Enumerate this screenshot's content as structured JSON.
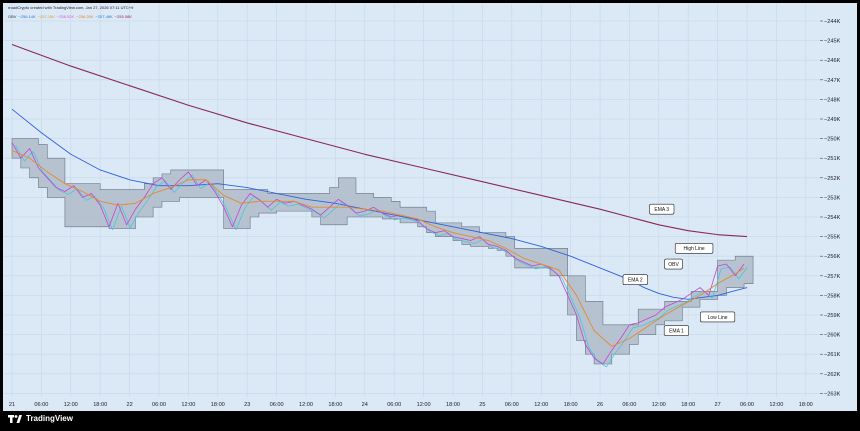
{
  "header": {
    "credit": "rroadCrypto created with TradingView.com, Jan 27, 2026 07:11 UTC+9",
    "legend": [
      {
        "text": "OBV",
        "color": "#333333"
      },
      {
        "text": "−256.14K",
        "color": "#2b7bd6"
      },
      {
        "text": "−257.15K",
        "color": "#e0a030"
      },
      {
        "text": "−256.52K",
        "color": "#d658d6"
      },
      {
        "text": "−256.26K",
        "color": "#e58a2a"
      },
      {
        "text": "−257.46K",
        "color": "#2b7bd6"
      },
      {
        "text": "−255.08K",
        "color": "#9a2a5a"
      }
    ]
  },
  "footer": {
    "brand": "TradingView"
  },
  "colors": {
    "background": "#dbe8f6",
    "grid": "#c7d7e8",
    "obv": "#c246d6",
    "obv_cyan": "#3fc6d8",
    "ema1": "#e58a2a",
    "ema2": "#2b62e0",
    "ema3": "#8a2a55",
    "band_fill": "#a9b5c3",
    "band_edge": "#6a7482"
  },
  "chart_data": {
    "type": "line",
    "title": "OBV",
    "x_labels": [
      "21",
      "06:00",
      "12:00",
      "18:00",
      "22",
      "06:00",
      "12:00",
      "18:00",
      "23",
      "06:00",
      "12:00",
      "18:00",
      "24",
      "06:00",
      "12:00",
      "18:00",
      "25",
      "06:00",
      "12:00",
      "18:00",
      "26",
      "06:00",
      "12:00",
      "18:00",
      "27",
      "06:00",
      "12:00",
      "18:00"
    ],
    "y_tick_labels": [
      "−244K",
      "−245K",
      "−246K",
      "−247K",
      "−248K",
      "−249K",
      "−250K",
      "−251K",
      "−252K",
      "−253K",
      "−254K",
      "−255K",
      "−256K",
      "−257K",
      "−258K",
      "−259K",
      "−260K",
      "−261K",
      "−262K",
      "−263K"
    ],
    "ylim": [
      -263,
      -244
    ],
    "y_unit": "K",
    "xlim": [
      0,
      27.3
    ],
    "grid": true,
    "series": [
      {
        "name": "OBV",
        "color": "#c246d6",
        "x": [
          0,
          0.3,
          0.6,
          0.9,
          1.2,
          1.5,
          1.8,
          2.1,
          2.4,
          2.7,
          3.0,
          3.3,
          3.6,
          3.9,
          4.2,
          4.5,
          4.8,
          5.1,
          5.4,
          5.7,
          6.0,
          6.3,
          6.6,
          6.9,
          7.2,
          7.5,
          7.8,
          8.1,
          8.4,
          8.7,
          9.0,
          9.3,
          9.6,
          9.9,
          10.2,
          10.5,
          10.8,
          11.1,
          11.4,
          11.7,
          12.0,
          12.3,
          12.6,
          12.9,
          13.2,
          13.5,
          13.8,
          14.1,
          14.4,
          14.7,
          15.0,
          15.3,
          15.6,
          15.9,
          16.2,
          16.5,
          16.8,
          17.1,
          17.4,
          17.7,
          18.0,
          18.3,
          18.6,
          18.9,
          19.2,
          19.5,
          19.8,
          20.1,
          20.4,
          20.7,
          21.0,
          21.3,
          21.6,
          21.9,
          22.2,
          22.5,
          22.8,
          23.1,
          23.4,
          23.7,
          24.0,
          24.3,
          24.6,
          24.9
        ],
        "y": [
          -250.2,
          -251.0,
          -250.5,
          -251.5,
          -252.0,
          -252.5,
          -252.7,
          -252.4,
          -253.0,
          -252.8,
          -253.4,
          -254.5,
          -253.3,
          -254.4,
          -253.6,
          -253.0,
          -252.3,
          -252.0,
          -252.6,
          -252.1,
          -251.7,
          -252.4,
          -252.1,
          -252.7,
          -253.5,
          -254.5,
          -253.4,
          -252.8,
          -253.1,
          -253.5,
          -253.1,
          -253.3,
          -253.2,
          -253.4,
          -253.6,
          -253.9,
          -253.5,
          -253.1,
          -253.4,
          -253.8,
          -253.7,
          -253.5,
          -253.8,
          -254.0,
          -253.9,
          -254.0,
          -254.2,
          -254.6,
          -254.8,
          -254.7,
          -255.0,
          -255.1,
          -255.2,
          -255.0,
          -255.4,
          -255.5,
          -255.7,
          -256.1,
          -256.3,
          -256.5,
          -256.4,
          -256.6,
          -257.0,
          -258.0,
          -259.0,
          -260.5,
          -261.2,
          -261.5,
          -260.8,
          -260.2,
          -259.5,
          -259.4,
          -259.2,
          -259.0,
          -258.6,
          -258.4,
          -258.2,
          -257.9,
          -257.6,
          -258.0,
          -256.5,
          -256.4,
          -257.0,
          -256.4
        ]
      },
      {
        "name": "EMA 1",
        "color": "#e58a2a",
        "x": [
          0,
          0.6,
          1.2,
          1.8,
          2.4,
          3.0,
          3.6,
          4.2,
          4.8,
          5.4,
          6.0,
          6.6,
          7.2,
          7.8,
          8.4,
          9.0,
          9.6,
          10.2,
          10.8,
          11.4,
          12.0,
          12.6,
          13.2,
          13.8,
          14.4,
          15.0,
          15.6,
          16.2,
          16.8,
          17.4,
          18.0,
          18.6,
          19.2,
          19.8,
          20.4,
          21.0,
          21.6,
          22.2,
          22.8,
          23.4,
          24.0,
          24.6,
          24.9
        ],
        "y": [
          -250.6,
          -251.0,
          -251.7,
          -252.3,
          -252.7,
          -253.2,
          -253.4,
          -253.3,
          -252.8,
          -252.5,
          -252.1,
          -252.1,
          -252.9,
          -253.3,
          -253.2,
          -253.2,
          -253.2,
          -253.5,
          -253.5,
          -253.5,
          -253.6,
          -253.7,
          -253.9,
          -254.1,
          -254.5,
          -254.8,
          -255.0,
          -255.2,
          -255.6,
          -256.1,
          -256.4,
          -256.7,
          -258.0,
          -259.8,
          -260.6,
          -260.2,
          -259.6,
          -259.0,
          -258.5,
          -258.0,
          -257.4,
          -256.9,
          -256.6
        ]
      },
      {
        "name": "EMA 2",
        "color": "#2b62e0",
        "x": [
          0,
          1,
          2,
          3,
          4,
          5,
          6,
          7,
          8,
          9,
          10,
          11,
          12,
          13,
          14,
          15,
          16,
          17,
          18,
          19,
          20,
          21,
          21.5,
          22,
          22.5,
          23,
          23.5,
          24,
          24.5,
          25
        ],
        "y": [
          -248.5,
          -249.7,
          -250.8,
          -251.6,
          -252.1,
          -252.4,
          -252.4,
          -252.3,
          -252.5,
          -252.8,
          -253.1,
          -253.3,
          -253.6,
          -253.9,
          -254.2,
          -254.5,
          -254.8,
          -255.1,
          -255.5,
          -256.0,
          -256.6,
          -257.2,
          -257.6,
          -257.9,
          -258.1,
          -258.2,
          -258.1,
          -258.0,
          -257.8,
          -257.6
        ]
      },
      {
        "name": "EMA 3",
        "color": "#8a2a55",
        "x": [
          0,
          2,
          4,
          6,
          8,
          10,
          12,
          14,
          16,
          18,
          20,
          21,
          22,
          23,
          24,
          25
        ],
        "y": [
          -245.2,
          -246.3,
          -247.3,
          -248.3,
          -249.2,
          -250.0,
          -250.8,
          -251.5,
          -252.2,
          -252.9,
          -253.6,
          -254.0,
          -254.4,
          -254.7,
          -254.9,
          -255.0
        ]
      }
    ],
    "band": {
      "name": "High Line / Low Line",
      "color": "#a9b5c3",
      "x": [
        0,
        0.3,
        0.6,
        0.9,
        1.2,
        1.5,
        1.8,
        2.1,
        2.4,
        2.7,
        3.0,
        3.3,
        3.6,
        3.9,
        4.2,
        4.5,
        4.8,
        5.1,
        5.4,
        5.7,
        6.0,
        6.3,
        6.6,
        6.9,
        7.2,
        7.5,
        7.8,
        8.1,
        8.4,
        8.7,
        9.0,
        9.3,
        9.6,
        9.9,
        10.2,
        10.5,
        10.8,
        11.1,
        11.4,
        11.7,
        12.0,
        12.3,
        12.6,
        12.9,
        13.2,
        13.5,
        13.8,
        14.1,
        14.4,
        14.7,
        15.0,
        15.3,
        15.6,
        15.9,
        16.2,
        16.5,
        16.8,
        17.1,
        17.4,
        17.7,
        18.0,
        18.3,
        18.6,
        18.9,
        19.2,
        19.5,
        19.8,
        20.1,
        20.4,
        20.7,
        21.0,
        21.3,
        21.6,
        21.9,
        22.2,
        22.5,
        22.8,
        23.1,
        23.4,
        23.7,
        24.0,
        24.3,
        24.6,
        24.9
      ],
      "high": [
        -250.0,
        -250.0,
        -250.0,
        -250.3,
        -251.0,
        -251.0,
        -252.3,
        -252.3,
        -252.3,
        -252.3,
        -252.6,
        -252.6,
        -252.6,
        -252.6,
        -252.6,
        -252.3,
        -252.0,
        -251.8,
        -251.6,
        -251.6,
        -251.6,
        -251.6,
        -251.6,
        -251.6,
        -252.6,
        -252.6,
        -252.6,
        -252.6,
        -252.6,
        -252.8,
        -252.8,
        -252.8,
        -252.8,
        -252.8,
        -252.8,
        -252.8,
        -252.5,
        -252.0,
        -252.0,
        -252.8,
        -252.8,
        -253.0,
        -253.0,
        -253.2,
        -253.5,
        -253.5,
        -253.5,
        -253.7,
        -254.3,
        -254.3,
        -254.3,
        -254.5,
        -254.5,
        -254.8,
        -254.8,
        -254.8,
        -255.0,
        -255.6,
        -255.6,
        -255.6,
        -255.6,
        -255.6,
        -255.6,
        -257.0,
        -257.0,
        -258.3,
        -258.3,
        -259.5,
        -259.5,
        -259.5,
        -259.5,
        -258.7,
        -258.7,
        -258.7,
        -258.3,
        -258.3,
        -258.3,
        -257.8,
        -257.8,
        -257.8,
        -256.2,
        -256.2,
        -256.0,
        -256.0
      ],
      "low": [
        -251.0,
        -251.5,
        -252.0,
        -252.5,
        -253.0,
        -253.0,
        -254.5,
        -254.5,
        -254.5,
        -254.5,
        -254.5,
        -254.6,
        -254.6,
        -254.6,
        -254.0,
        -254.0,
        -253.5,
        -253.2,
        -253.2,
        -253.0,
        -253.0,
        -253.0,
        -253.0,
        -253.0,
        -254.6,
        -254.6,
        -254.6,
        -254.0,
        -253.8,
        -253.8,
        -253.7,
        -253.7,
        -253.7,
        -253.7,
        -254.0,
        -254.4,
        -254.4,
        -254.4,
        -254.0,
        -254.0,
        -254.0,
        -254.0,
        -254.1,
        -254.1,
        -254.3,
        -254.3,
        -254.5,
        -254.8,
        -255.0,
        -255.0,
        -255.2,
        -255.4,
        -255.5,
        -255.5,
        -255.6,
        -255.7,
        -256.0,
        -256.6,
        -256.6,
        -256.6,
        -256.6,
        -257.0,
        -257.0,
        -259.0,
        -260.3,
        -261.0,
        -261.5,
        -261.5,
        -261.0,
        -261.0,
        -260.5,
        -260.0,
        -260.0,
        -259.5,
        -259.3,
        -259.3,
        -258.6,
        -258.6,
        -258.2,
        -258.2,
        -258.0,
        -257.6,
        -257.6,
        -257.4
      ]
    },
    "annotations": [
      {
        "text": "EMA 3",
        "x": 22.1,
        "y": -253.6
      },
      {
        "text": "High Line",
        "x": 23.2,
        "y": -255.6
      },
      {
        "text": "OBV",
        "x": 22.5,
        "y": -256.4
      },
      {
        "text": "EMA 2",
        "x": 21.2,
        "y": -257.2
      },
      {
        "text": "EMA 1",
        "x": 22.6,
        "y": -259.8
      },
      {
        "text": "Low Line",
        "x": 24.0,
        "y": -259.1
      }
    ]
  }
}
